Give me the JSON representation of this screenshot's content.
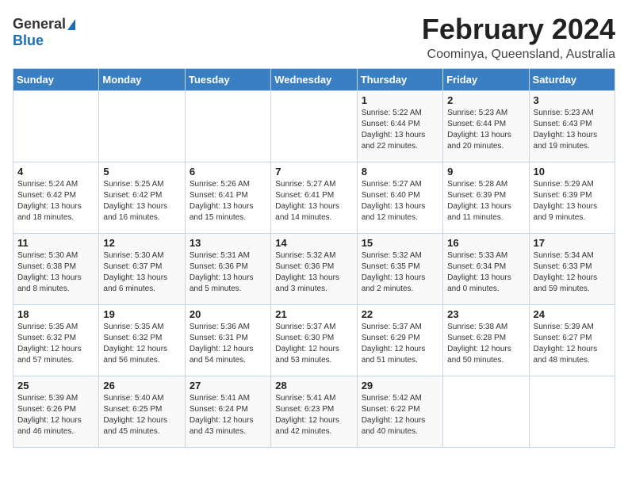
{
  "logo": {
    "general": "General",
    "blue": "Blue"
  },
  "title": "February 2024",
  "subtitle": "Coominya, Queensland, Australia",
  "days_of_week": [
    "Sunday",
    "Monday",
    "Tuesday",
    "Wednesday",
    "Thursday",
    "Friday",
    "Saturday"
  ],
  "weeks": [
    [
      {
        "day": "",
        "info": ""
      },
      {
        "day": "",
        "info": ""
      },
      {
        "day": "",
        "info": ""
      },
      {
        "day": "",
        "info": ""
      },
      {
        "day": "1",
        "info": "Sunrise: 5:22 AM\nSunset: 6:44 PM\nDaylight: 13 hours\nand 22 minutes."
      },
      {
        "day": "2",
        "info": "Sunrise: 5:23 AM\nSunset: 6:44 PM\nDaylight: 13 hours\nand 20 minutes."
      },
      {
        "day": "3",
        "info": "Sunrise: 5:23 AM\nSunset: 6:43 PM\nDaylight: 13 hours\nand 19 minutes."
      }
    ],
    [
      {
        "day": "4",
        "info": "Sunrise: 5:24 AM\nSunset: 6:42 PM\nDaylight: 13 hours\nand 18 minutes."
      },
      {
        "day": "5",
        "info": "Sunrise: 5:25 AM\nSunset: 6:42 PM\nDaylight: 13 hours\nand 16 minutes."
      },
      {
        "day": "6",
        "info": "Sunrise: 5:26 AM\nSunset: 6:41 PM\nDaylight: 13 hours\nand 15 minutes."
      },
      {
        "day": "7",
        "info": "Sunrise: 5:27 AM\nSunset: 6:41 PM\nDaylight: 13 hours\nand 14 minutes."
      },
      {
        "day": "8",
        "info": "Sunrise: 5:27 AM\nSunset: 6:40 PM\nDaylight: 13 hours\nand 12 minutes."
      },
      {
        "day": "9",
        "info": "Sunrise: 5:28 AM\nSunset: 6:39 PM\nDaylight: 13 hours\nand 11 minutes."
      },
      {
        "day": "10",
        "info": "Sunrise: 5:29 AM\nSunset: 6:39 PM\nDaylight: 13 hours\nand 9 minutes."
      }
    ],
    [
      {
        "day": "11",
        "info": "Sunrise: 5:30 AM\nSunset: 6:38 PM\nDaylight: 13 hours\nand 8 minutes."
      },
      {
        "day": "12",
        "info": "Sunrise: 5:30 AM\nSunset: 6:37 PM\nDaylight: 13 hours\nand 6 minutes."
      },
      {
        "day": "13",
        "info": "Sunrise: 5:31 AM\nSunset: 6:36 PM\nDaylight: 13 hours\nand 5 minutes."
      },
      {
        "day": "14",
        "info": "Sunrise: 5:32 AM\nSunset: 6:36 PM\nDaylight: 13 hours\nand 3 minutes."
      },
      {
        "day": "15",
        "info": "Sunrise: 5:32 AM\nSunset: 6:35 PM\nDaylight: 13 hours\nand 2 minutes."
      },
      {
        "day": "16",
        "info": "Sunrise: 5:33 AM\nSunset: 6:34 PM\nDaylight: 13 hours\nand 0 minutes."
      },
      {
        "day": "17",
        "info": "Sunrise: 5:34 AM\nSunset: 6:33 PM\nDaylight: 12 hours\nand 59 minutes."
      }
    ],
    [
      {
        "day": "18",
        "info": "Sunrise: 5:35 AM\nSunset: 6:32 PM\nDaylight: 12 hours\nand 57 minutes."
      },
      {
        "day": "19",
        "info": "Sunrise: 5:35 AM\nSunset: 6:32 PM\nDaylight: 12 hours\nand 56 minutes."
      },
      {
        "day": "20",
        "info": "Sunrise: 5:36 AM\nSunset: 6:31 PM\nDaylight: 12 hours\nand 54 minutes."
      },
      {
        "day": "21",
        "info": "Sunrise: 5:37 AM\nSunset: 6:30 PM\nDaylight: 12 hours\nand 53 minutes."
      },
      {
        "day": "22",
        "info": "Sunrise: 5:37 AM\nSunset: 6:29 PM\nDaylight: 12 hours\nand 51 minutes."
      },
      {
        "day": "23",
        "info": "Sunrise: 5:38 AM\nSunset: 6:28 PM\nDaylight: 12 hours\nand 50 minutes."
      },
      {
        "day": "24",
        "info": "Sunrise: 5:39 AM\nSunset: 6:27 PM\nDaylight: 12 hours\nand 48 minutes."
      }
    ],
    [
      {
        "day": "25",
        "info": "Sunrise: 5:39 AM\nSunset: 6:26 PM\nDaylight: 12 hours\nand 46 minutes."
      },
      {
        "day": "26",
        "info": "Sunrise: 5:40 AM\nSunset: 6:25 PM\nDaylight: 12 hours\nand 45 minutes."
      },
      {
        "day": "27",
        "info": "Sunrise: 5:41 AM\nSunset: 6:24 PM\nDaylight: 12 hours\nand 43 minutes."
      },
      {
        "day": "28",
        "info": "Sunrise: 5:41 AM\nSunset: 6:23 PM\nDaylight: 12 hours\nand 42 minutes."
      },
      {
        "day": "29",
        "info": "Sunrise: 5:42 AM\nSunset: 6:22 PM\nDaylight: 12 hours\nand 40 minutes."
      },
      {
        "day": "",
        "info": ""
      },
      {
        "day": "",
        "info": ""
      }
    ]
  ]
}
